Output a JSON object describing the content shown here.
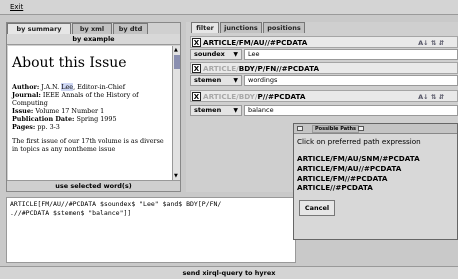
{
  "menu": {
    "exit_label": "Exit"
  },
  "left": {
    "tabs": [
      "by summary",
      "by xml",
      "by dtd"
    ],
    "header": "by example",
    "doc": {
      "title": "About this Issue",
      "author_label": "Author:",
      "author_pre": "J.A.N. ",
      "author_hl": "Lee",
      "author_post": ", Editor-in-Chief",
      "journal_label": "Journal:",
      "journal_value": "IEEE Annals of the History of Computing",
      "issue_label": "Issue:",
      "issue_value": "Volume 17 Number 1",
      "pubdate_label": "Publication Date:",
      "pubdate_value": "Spring 1995",
      "pages_label": "Pages:",
      "pages_value": "pp. 3-3",
      "body": "The first issue of our 17th volume is as diverse in topics as any nontheme issue"
    },
    "use_button": "use selected word(s)"
  },
  "right": {
    "tabs": [
      "filter",
      "junctions",
      "positions"
    ],
    "rows": [
      {
        "x": "X",
        "path_a": "",
        "path_b": "ARTICLE/FM/AU//#PCDATA",
        "icons": "A↓ ⇅ ⇵",
        "select": "soundex",
        "value": "Lee"
      },
      {
        "x": "X",
        "path_a": "ARTICLE/",
        "path_b": "BDY/P/FN//#PCDATA",
        "icons": "",
        "select": "stemen",
        "value": "wordings"
      },
      {
        "x": "X",
        "path_a": "ARTICLE/BDY/",
        "path_b": "P//#PCDATA",
        "icons": "A↓ ⇅ ⇵",
        "select": "stemen",
        "value": "balance"
      }
    ]
  },
  "popup": {
    "title": "Possible Paths",
    "prompt": "Click on preferred path expression",
    "options": [
      "ARTICLE/FM/AU/SNM/#PCDATA",
      "ARTICLE/FM/AU//#PCDATA",
      "ARTICLE/FM//#PCDATA",
      "ARTICLE//#PCDATA"
    ],
    "cancel": "Cancel"
  },
  "query": {
    "line1": "ARTICLE[FM/AU//#PCDATA $soundex$ \"Lee\" $and$ BDY[P/FN/",
    "line2": ".//#PCDATA $stemen$ \"balance\"]]"
  },
  "send_button": "send xirql-query to hyrex"
}
